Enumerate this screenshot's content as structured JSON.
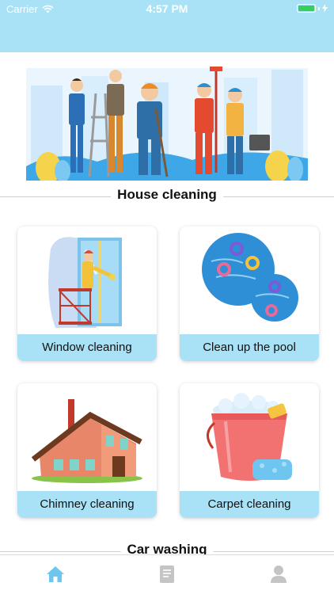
{
  "status_bar": {
    "carrier": "Carrier",
    "time": "4:57 PM",
    "battery_level": 1.0
  },
  "colors": {
    "header": "#a9e2f6",
    "label_bg": "#a9e2f6",
    "tab_active": "#6fc6ec",
    "tab_inactive": "#c4c4c4"
  },
  "sections": [
    {
      "title": "House cleaning"
    },
    {
      "title": "Car washing"
    }
  ],
  "cards": [
    {
      "label": "Window cleaning",
      "icon": "window-cleaner-illustration"
    },
    {
      "label": "Clean up the pool",
      "icon": "pool-illustration"
    },
    {
      "label": "Chimney cleaning",
      "icon": "house-chimney-illustration"
    },
    {
      "label": "Carpet cleaning",
      "icon": "bucket-sponge-illustration"
    }
  ],
  "banner": {
    "icon": "cleaning-workers-illustration"
  },
  "tabbar": {
    "tabs": [
      {
        "icon": "home-icon",
        "active": true
      },
      {
        "icon": "document-icon",
        "active": false
      },
      {
        "icon": "user-icon",
        "active": false
      }
    ]
  }
}
